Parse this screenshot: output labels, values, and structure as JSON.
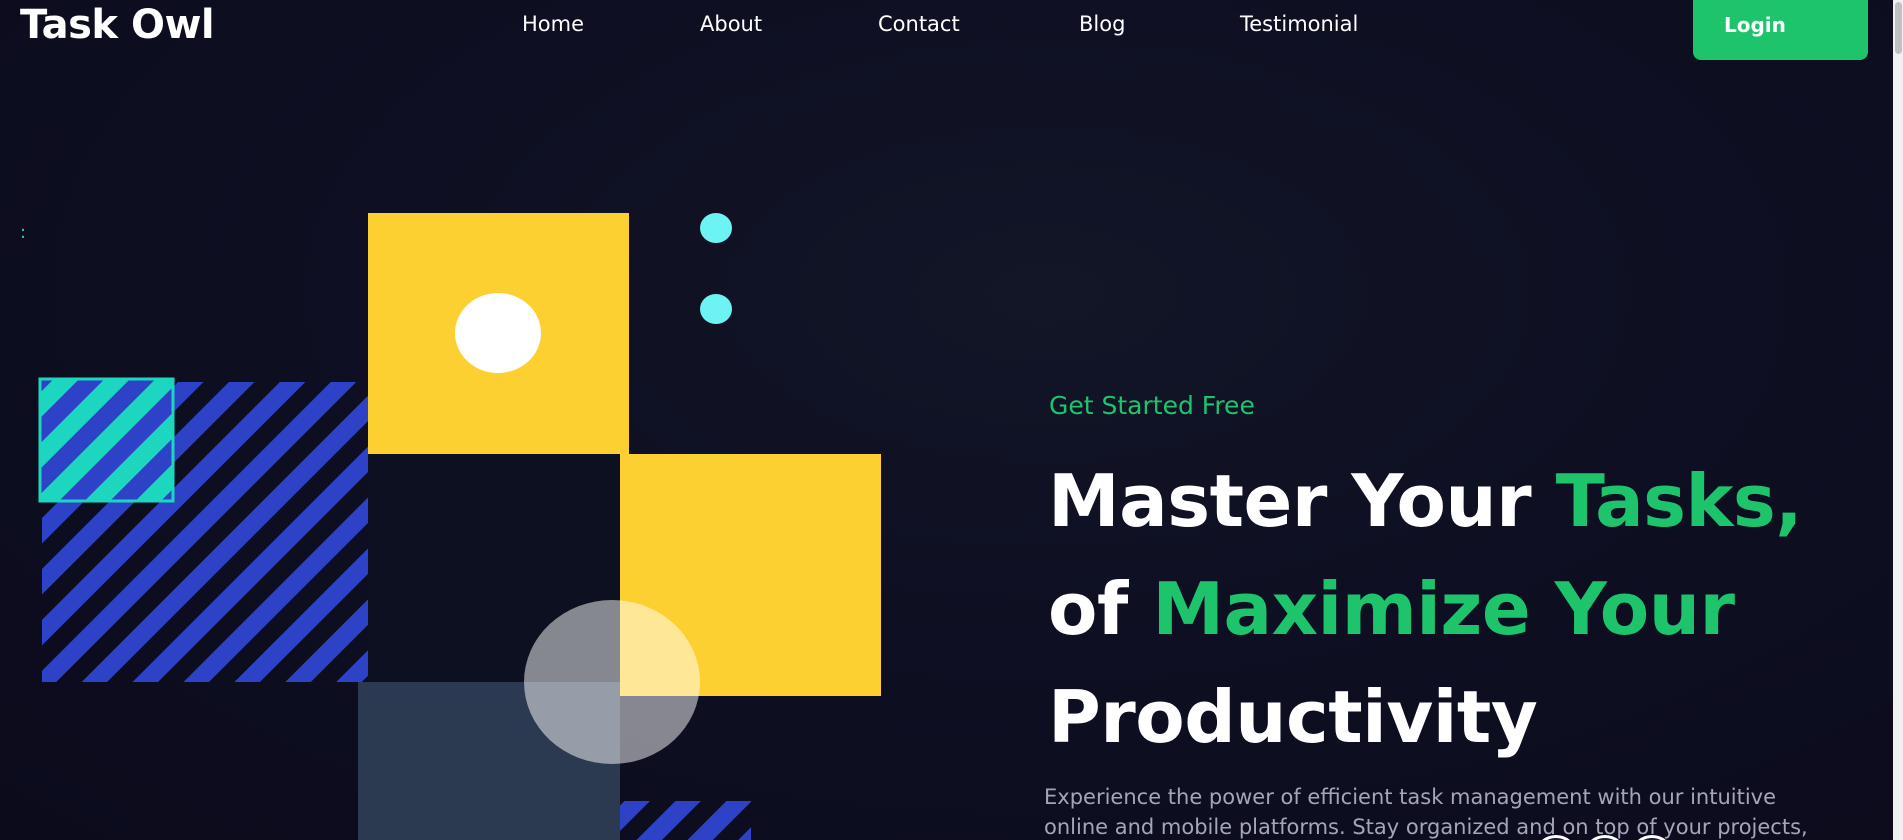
{
  "brand": {
    "name": "Task Owl"
  },
  "nav": {
    "links": [
      "Home",
      "About",
      "Contact",
      "Blog",
      "Testimonial"
    ],
    "login_label": "Login"
  },
  "decor": {
    "dots_mark": ":"
  },
  "hero": {
    "eyebrow": "Get Started Free",
    "headline": {
      "line1_white": "Master Your ",
      "line1_accent": "Tasks,",
      "line2_white": "of ",
      "line2_accent": "Maximize Your",
      "line3_white": "Productivity"
    },
    "description_line1": "Experience the power of efficient task management with our intuitive",
    "description_line2": "online and mobile platforms. Stay organized and on top of your projects,"
  },
  "colors": {
    "background": "#0d0c1f",
    "accent_green": "#1ec46c",
    "yellow": "#fdd031",
    "stripe_blue": "#2e42c8",
    "teal": "#1dd6c0",
    "cyan_dot": "#6cf3f3",
    "slate": "#2c3a51"
  },
  "icons": [
    "scrollbar-thumb",
    "avatar-circle"
  ]
}
